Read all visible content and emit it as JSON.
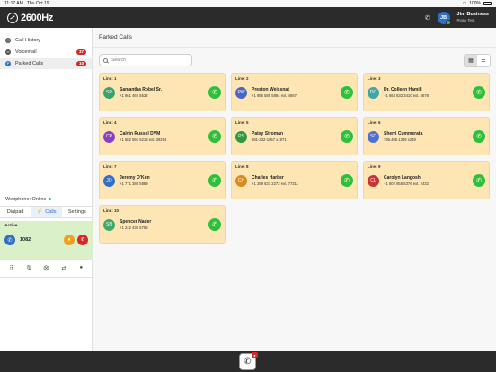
{
  "status_bar": {
    "time": "11:17 AM",
    "date": "Thu Oct 19",
    "battery": "100%"
  },
  "header": {
    "brand": "2600Hz",
    "user": {
      "initials": "JB",
      "name": "Jim Business",
      "sub": "Ryan Test"
    }
  },
  "sidebar": {
    "items": [
      {
        "label": "Call History",
        "icon": "clock-icon",
        "badge": ""
      },
      {
        "label": "Voicemail",
        "icon": "voicemail-icon",
        "badge": "37"
      },
      {
        "label": "Parked Calls",
        "icon": "park-icon",
        "badge": "10"
      }
    ],
    "active_index": 2
  },
  "webphone": {
    "title": "Webphone: Online",
    "tabs": [
      "Dialpad",
      "Calls",
      "Settings"
    ],
    "active_tab": "Calls",
    "active_call": {
      "label": "Active",
      "extension": "1082"
    }
  },
  "main": {
    "title": "Parked Calls",
    "search_placeholder": "Search",
    "view_mode": "grid"
  },
  "parked_calls": [
    {
      "line": "Line: 1",
      "initials": "SR",
      "name": "Samantha Robel Sr.",
      "number": "+1 661 462 5532",
      "color": "#3aa36b"
    },
    {
      "line": "Line: 2",
      "initials": "PW",
      "name": "Preston Weissnat",
      "number": "+1 956 585 5884 ext. 4687",
      "color": "#4a64c8"
    },
    {
      "line": "Line: 3",
      "initials": "DC",
      "name": "Dr. Colleen Hamill",
      "number": "+1 664 632 3410 ext. 4678",
      "color": "#3ea8a6"
    },
    {
      "line": "Line: 4",
      "initials": "CR",
      "name": "Calvin Russel DVM",
      "number": "+1 582 591 5218 ext. 39284",
      "color": "#8a3fc2"
    },
    {
      "line": "Line: 5",
      "initials": "PS",
      "name": "Patsy Stroman",
      "number": "981-232-1057 x1971",
      "color": "#2e9a3e"
    },
    {
      "line": "Line: 6",
      "initials": "SC",
      "name": "Sherri Cummerata",
      "number": "795.405.1339 x249",
      "color": "#4f6fd2"
    },
    {
      "line": "Line: 7",
      "initials": "JO",
      "name": "Jeremy O'Kon",
      "number": "+1 771 383 5889",
      "color": "#2f6fc6"
    },
    {
      "line": "Line: 8",
      "initials": "CH",
      "name": "Charles Harber",
      "number": "+1 259 637 2272 ext. 77311",
      "color": "#d98a1c"
    },
    {
      "line": "Line: 9",
      "initials": "CL",
      "name": "Carolyn Langosh",
      "number": "+1 802 855 5376 ext. 2432",
      "color": "#c93434"
    },
    {
      "line": "Line: 10",
      "initials": "SN",
      "name": "Spencer Nader",
      "number": "+1 242 430 6756",
      "color": "#3ea86a"
    }
  ]
}
